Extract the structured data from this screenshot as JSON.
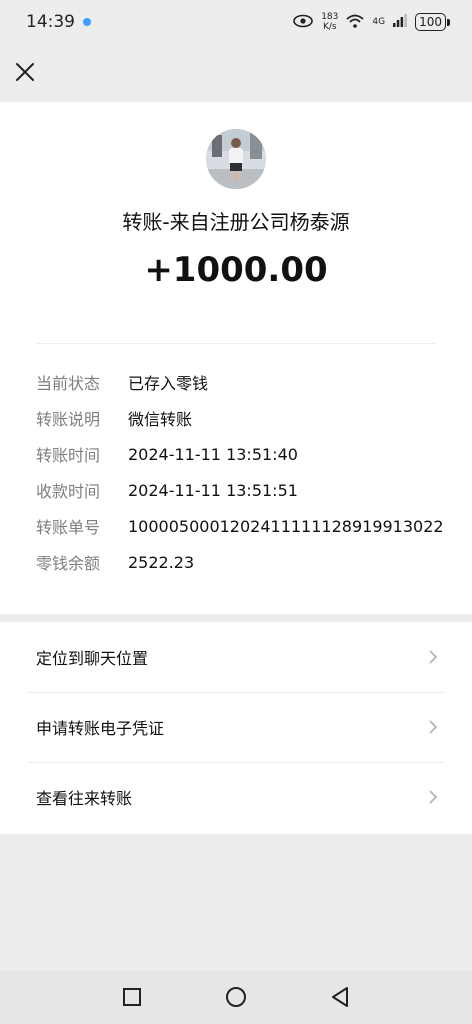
{
  "status": {
    "time": "14:39",
    "net_speed_value": "183",
    "net_speed_unit": "K/s",
    "network": "4G",
    "battery": "100"
  },
  "transfer": {
    "title": "转账-来自注册公司杨泰源",
    "amount": "+1000.00"
  },
  "details": [
    {
      "label": "当前状态",
      "value": "已存入零钱"
    },
    {
      "label": "转账说明",
      "value": "微信转账"
    },
    {
      "label": "转账时间",
      "value": "2024-11-11 13:51:40"
    },
    {
      "label": "收款时间",
      "value": "2024-11-11 13:51:51"
    },
    {
      "label": "转账单号",
      "value": "1000050001202411111128919913022"
    },
    {
      "label": "零钱余额",
      "value": "2522.23"
    }
  ],
  "menu": [
    {
      "label": "定位到聊天位置"
    },
    {
      "label": "申请转账电子凭证"
    },
    {
      "label": "查看往来转账"
    }
  ],
  "icons": {
    "close": "close-icon",
    "chevron": "chevron-right-icon",
    "nav": [
      "square-icon",
      "circle-icon",
      "triangle-back-icon"
    ]
  }
}
